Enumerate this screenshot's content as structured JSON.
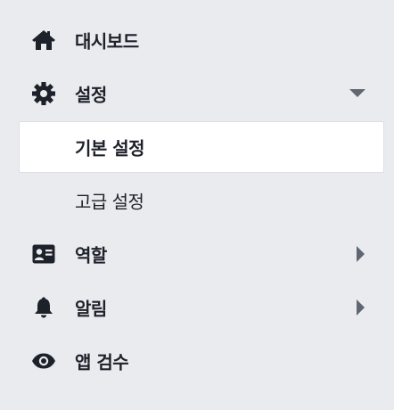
{
  "nav": {
    "dashboard": {
      "label": "대시보드",
      "icon": "home-icon"
    },
    "settings": {
      "label": "설정",
      "icon": "gear-icon",
      "expanded": true,
      "children": [
        {
          "label": "기본 설정",
          "active": true
        },
        {
          "label": "고급 설정",
          "active": false
        }
      ]
    },
    "roles": {
      "label": "역할",
      "icon": "contact-card-icon"
    },
    "alerts": {
      "label": "알림",
      "icon": "bell-icon"
    },
    "app_review": {
      "label": "앱 검수",
      "icon": "eye-icon"
    }
  },
  "colors": {
    "background": "#e9ebee",
    "text": "#1d2129",
    "icon": "#1d2129",
    "arrow": "#606770",
    "active_bg": "#ffffff",
    "active_border": "#dddfe2"
  }
}
